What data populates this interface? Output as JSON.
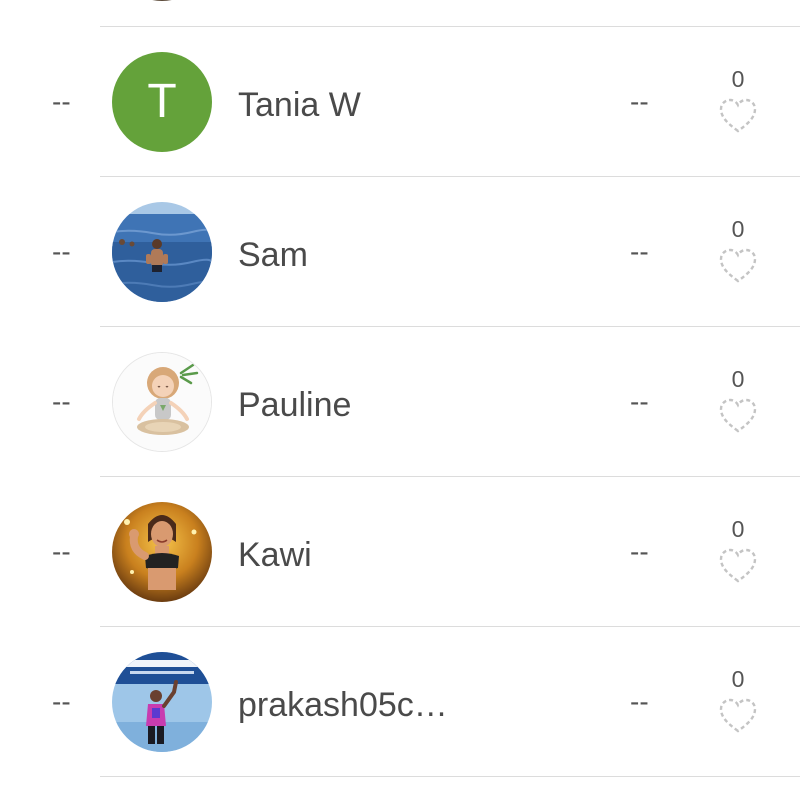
{
  "leaderboard": {
    "rows": [
      {
        "rank": "--",
        "initial": "T",
        "name": "Tania W",
        "stat": "--",
        "kudos": "0"
      },
      {
        "rank": "--",
        "name": "Sam",
        "stat": "--",
        "kudos": "0"
      },
      {
        "rank": "--",
        "name": "Pauline",
        "stat": "--",
        "kudos": "0"
      },
      {
        "rank": "--",
        "name": "Kawi",
        "stat": "--",
        "kudos": "0"
      },
      {
        "rank": "--",
        "name": "prakash05c…",
        "stat": "--",
        "kudos": "0"
      }
    ]
  },
  "colors": {
    "initial_avatar_bg": "#64a23a",
    "divider": "#dcdcdc",
    "heart_outline": "#c4c4c4"
  },
  "icons": {
    "kudos": "heart-outline-icon"
  }
}
